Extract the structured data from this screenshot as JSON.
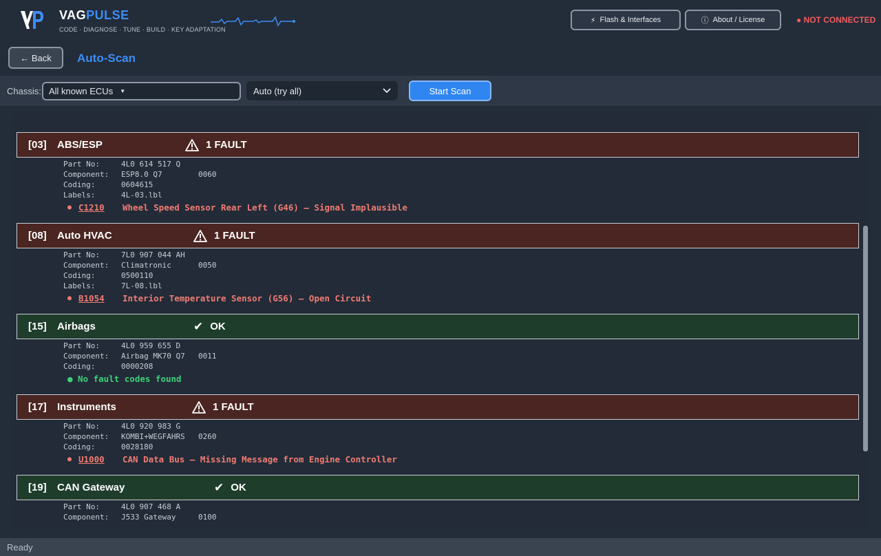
{
  "header": {
    "brand_vag": "VAG",
    "brand_pulse": "PULSE",
    "tagline": "CODE · DIAGNOSE · TUNE · BUILD · KEY ADAPTATION",
    "flash_label": "Flash & Interfaces",
    "about_label": "About / License",
    "connection_status": "● NOT CONNECTED",
    "colors": {
      "accent": "#3d8df5",
      "danger": "#f25c5c"
    }
  },
  "nav": {
    "back_label": "← Back",
    "page_title": "Auto-Scan"
  },
  "toolbar": {
    "chassis_label": "Chassis:",
    "chassis_value": "All known ECUs",
    "protocol_value": "Auto (try all)",
    "start_label": "Start Scan"
  },
  "labels": {
    "part_no": "Part No:",
    "component": "Component:",
    "coding": "Coding:",
    "labels": "Labels:"
  },
  "modules": [
    {
      "address": "[03]",
      "name": "ABS/ESP",
      "status": "fault",
      "status_icon": "warning-icon",
      "status_text": "1 FAULT",
      "part_no": "4L0 614 517 Q",
      "component": "ESP8.0 Q7",
      "component_ver": "0060",
      "coding": "0604615",
      "labels": "4L-03.lbl",
      "dtc_code": "C1210",
      "dtc_text": "Wheel Speed Sensor Rear Left (G46) — Signal Implausible"
    },
    {
      "address": "[08]",
      "name": "Auto HVAC",
      "status": "fault",
      "status_icon": "warning-icon",
      "status_text": "1 FAULT",
      "part_no": "7L0 907 044 AH",
      "component": "Climatronic",
      "component_ver": "0050",
      "coding": "0500110",
      "labels": "7L-08.lbl",
      "dtc_code": "B1054",
      "dtc_text": "Interior Temperature Sensor (G56) — Open Circuit"
    },
    {
      "address": "[15]",
      "name": "Airbags",
      "status": "ok",
      "status_icon": "check-icon",
      "status_text": "OK",
      "part_no": "4L0 959 655 D",
      "component": "Airbag MK70 Q7",
      "component_ver": "0011",
      "coding": "0000208",
      "ok_text": "● No fault codes found"
    },
    {
      "address": "[17]",
      "name": "Instruments",
      "status": "fault",
      "status_icon": "warning-icon",
      "status_text": "1 FAULT",
      "part_no": "4L0 920 983 G",
      "component": "KOMBI+WEGFAHRS",
      "component_ver": "0260",
      "coding": "0028180",
      "dtc_code": "U1000",
      "dtc_text": "CAN Data Bus — Missing Message from Engine Controller"
    },
    {
      "address": "[19]",
      "name": "CAN Gateway",
      "status": "ok",
      "status_icon": "check-icon",
      "status_text": "OK",
      "part_no": "4L0 907 468 A",
      "component": "J533 Gateway",
      "component_ver": "0100"
    }
  ],
  "statusbar": {
    "text": "Ready"
  }
}
